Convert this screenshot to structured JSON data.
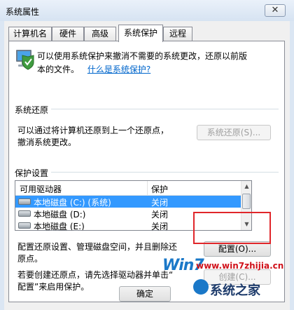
{
  "window": {
    "title": "系统属性",
    "close_glyph": "✕"
  },
  "tabs": [
    {
      "label": "计算机名"
    },
    {
      "label": "硬件"
    },
    {
      "label": "高级"
    },
    {
      "label": "系统保护",
      "active": true
    },
    {
      "label": "远程"
    }
  ],
  "intro": {
    "icon": "computer-shield-icon",
    "text_line1": "可以使用系统保护来撤消不需要的系统更改，还原以前版",
    "text_line2": "本的文件。",
    "link": "什么是系统保护?"
  },
  "system_restore": {
    "group_label": "系统还原",
    "desc_line1": "可以通过将计算机还原到上一个还原点，",
    "desc_line2": "撤消系统更改。",
    "button": "系统还原(S)..."
  },
  "protection": {
    "group_label": "保护设置",
    "columns": [
      "可用驱动器",
      "保护"
    ],
    "rows": [
      {
        "drive": "本地磁盘 (C:) (系统)",
        "protection": "关闭",
        "selected": true
      },
      {
        "drive": "本地磁盘 (D:)",
        "protection": "关闭"
      },
      {
        "drive": "本地磁盘 (E:)",
        "protection": "关闭"
      }
    ],
    "config_desc_line1": "配置还原设置、管理磁盘空间，并且删除还",
    "config_desc_line2": "原点。",
    "config_button": "配置(O)...",
    "create_desc_line1": "若要创建还原点，请先选择驱动器并单击“",
    "create_desc_line2": "配置”来启用保护。",
    "create_button": "创建(C)..."
  },
  "footer": {
    "ok_button": "确定"
  },
  "watermark": {
    "logo": "Win7",
    "url": "www.win7zhijia.cn",
    "brand": "系统之家"
  },
  "colors": {
    "selection": "#3399ff",
    "link": "#0066cc",
    "highlight": "#e0262a"
  }
}
